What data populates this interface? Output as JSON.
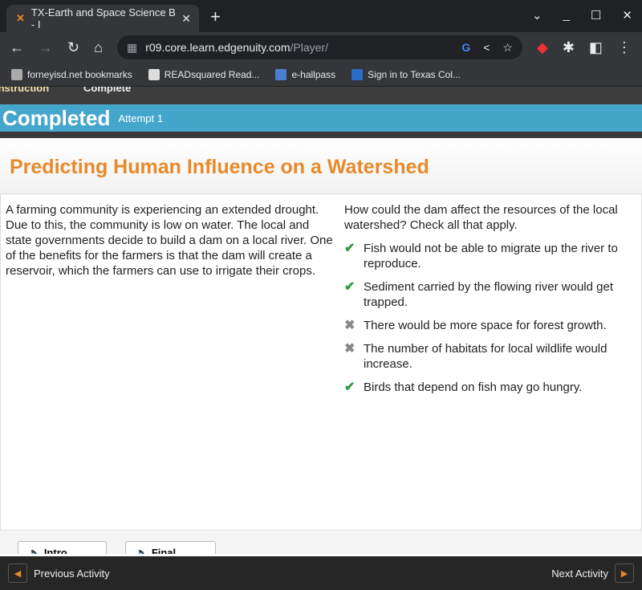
{
  "browser": {
    "tab_title": "TX-Earth and Space Science B - I",
    "url_host": "r09.core.learn.edgenuity.com",
    "url_path": "/Player/",
    "bookmarks": [
      "forneyisd.net bookmarks",
      "READsquared Read...",
      "e-hallpass",
      "Sign in to Texas Col..."
    ]
  },
  "nav": {
    "instruction": "Instruction",
    "complete": "Complete"
  },
  "status": {
    "label": "Completed",
    "attempt": "Attempt 1"
  },
  "activity": {
    "title": "Predicting Human Influence on a Watershed",
    "passage": "A farming community is experiencing an extended drought. Due to this, the community is low on water. The local and state governments decide to build a dam on a local river. One of the benefits for the farmers is that the dam will create a reservoir, which the farmers can use to irrigate their crops.",
    "question": "How could the dam affect the resources of the local watershed? Check all that apply.",
    "options": [
      {
        "text": "Fish would not be able to migrate up the river to reproduce.",
        "result": "correct"
      },
      {
        "text": "Sediment carried by the flowing river would get trapped.",
        "result": "correct"
      },
      {
        "text": "There would be more space for forest growth.",
        "result": "incorrect"
      },
      {
        "text": "The number of habitats for local wildlife would increase.",
        "result": "incorrect"
      },
      {
        "text": "Birds that depend on fish may go hungry.",
        "result": "correct"
      }
    ]
  },
  "audio": {
    "intro": "Intro",
    "final": "Final"
  },
  "footer": {
    "prev": "Previous Activity",
    "next": "Next Activity"
  },
  "colors": {
    "accent": "#e8892a",
    "banner": "#45a6cc",
    "check": "#2e9a3a"
  }
}
